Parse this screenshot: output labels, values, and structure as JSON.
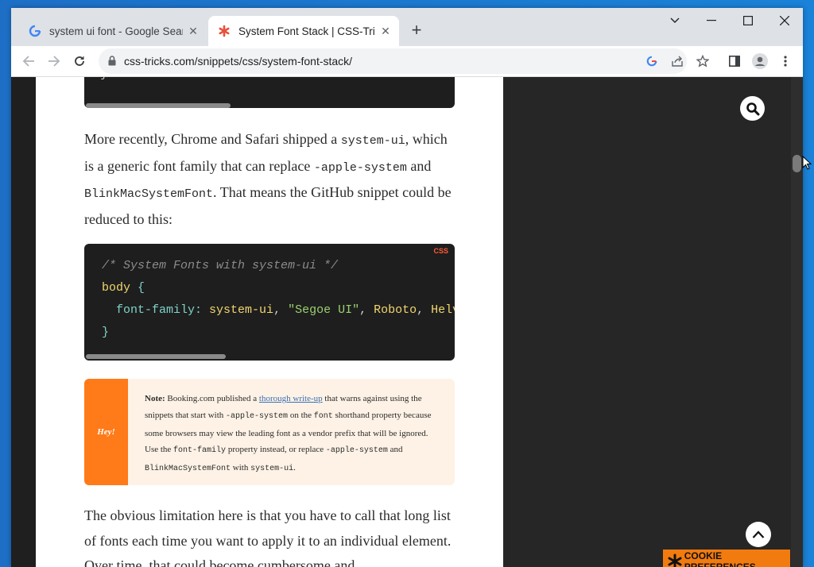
{
  "browser": {
    "tabs": [
      {
        "title": "system ui font - Google Search",
        "favicon": "google-icon",
        "active": false
      },
      {
        "title": "System Font Stack | CSS-Tricks",
        "favicon": "css-tricks-star-icon",
        "active": true
      }
    ],
    "new_tab_label": "+",
    "url": "css-tricks.com/snippets/css/system-font-stack/"
  },
  "article": {
    "top_code_tail": "}",
    "para1": {
      "t1": "More recently, Chrome and Safari shipped a ",
      "c1": "system-ui",
      "t2": ", which is a generic font family that can replace ",
      "c2": "-apple-system",
      "t3": " and ",
      "c3": "BlinkMacSystemFont",
      "t4": ". That means the GitHub snippet could be reduced to this:"
    },
    "code": {
      "lang": "CSS",
      "comment": "/* System Fonts with system-ui */",
      "selector": "body",
      "open_brace": " {",
      "property": "font-family",
      "colon": ": ",
      "v1": "system-ui",
      "sep1": ", ",
      "v2": "\"Segoe UI\"",
      "sep2": ", ",
      "v3": "Roboto",
      "sep3": ", ",
      "v4": "Helve",
      "close_brace": "}"
    },
    "note": {
      "tag": "Hey!",
      "label": "Note:",
      "t1": " Booking.com published a ",
      "link": "thorough write-up",
      "t2": " that warns against using the snippets that start with ",
      "c1": "-apple-system",
      "t3": " on the ",
      "c2": "font",
      "t4": " shorthand property because some browsers may view the leading font as a vendor prefix that will be ignored. Use the ",
      "c3": "font-family",
      "t5": " property instead, or replace ",
      "c4": "-apple-system",
      "t6": " and ",
      "c5": "BlinkMacSystemFont",
      "t7": " with ",
      "c6": "system-ui",
      "t8": "."
    },
    "para2": "The obvious limitation here is that you have to call that long list of fonts each time you want to apply it to an individual element. Over time, that could become cumbersome and"
  },
  "cookie": {
    "label": "COOKIE PREFERENCES"
  },
  "colors": {
    "accent": "#ff7a18",
    "cookie": "#f27b0f",
    "sidebar": "#262626"
  }
}
